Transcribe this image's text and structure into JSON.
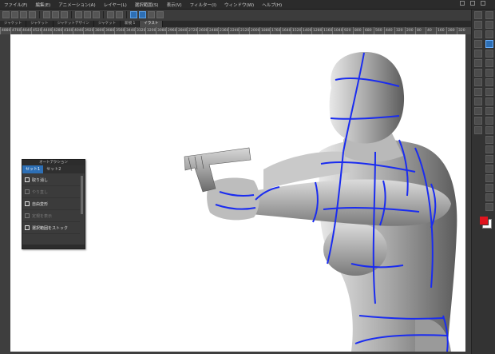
{
  "menubar": {
    "items": [
      "ファイル(F)",
      "編集(E)",
      "アニメーション(A)",
      "レイヤー(L)",
      "選択範囲(S)",
      "表示(V)",
      "フィルター(I)",
      "ウィンドウ(W)",
      "ヘルプ(H)"
    ]
  },
  "tabs": [
    "ジャケット",
    "ジャケット",
    "ジャケットデザイン",
    "ジャケット",
    "新規 1",
    "イラスト"
  ],
  "ruler": {
    "ticks": [
      "4880",
      "4760",
      "4640",
      "4520",
      "4400",
      "4280",
      "4160",
      "4040",
      "3920",
      "3800",
      "3680",
      "3560",
      "3440",
      "3320",
      "3200",
      "3080",
      "2960",
      "2840",
      "2720",
      "2600",
      "2480",
      "2360",
      "2240",
      "2120",
      "2000",
      "1880",
      "1760",
      "1640",
      "1520",
      "1400",
      "1280",
      "1160",
      "1040",
      "920",
      "800",
      "680",
      "560",
      "440",
      "320",
      "200",
      "80",
      "40",
      "160",
      "280",
      "320"
    ]
  },
  "panel": {
    "title": "オートアクション",
    "tabs": [
      "セット1",
      "セット2"
    ],
    "actions": [
      {
        "label": "取り消し",
        "enabled": true
      },
      {
        "label": "やり直し",
        "enabled": false
      },
      {
        "label": "自由変形",
        "enabled": true
      },
      {
        "label": "定規を表示",
        "enabled": false
      },
      {
        "label": "選択範囲をストック",
        "enabled": true
      }
    ]
  },
  "tools": {
    "col1": [
      "navigator-icon",
      "layer-icon",
      "folder-icon",
      "page-icon",
      "book-icon",
      "copy-icon",
      "frame-icon",
      "text-icon",
      "line-icon",
      "panel-icon",
      "list-icon",
      "gear-icon",
      "file-icon"
    ],
    "col2": [
      "zoom-icon",
      "hand-icon",
      "move-icon",
      "select-icon",
      "wand-icon",
      "eyedropper-icon",
      "pen-icon",
      "pencil-icon",
      "brush-icon",
      "airbrush-icon",
      "deco-icon",
      "eraser-icon",
      "blend-icon",
      "fill-icon",
      "gradient-icon",
      "figure-icon",
      "frame-border-icon",
      "ruler-icon",
      "text-tool-icon",
      "balloon-icon",
      "correct-icon"
    ]
  },
  "colors": {
    "main": "#e0141e",
    "sub": "#ffffff",
    "accent": "#2d6fb5",
    "wireframe": "#1a2cf0"
  }
}
